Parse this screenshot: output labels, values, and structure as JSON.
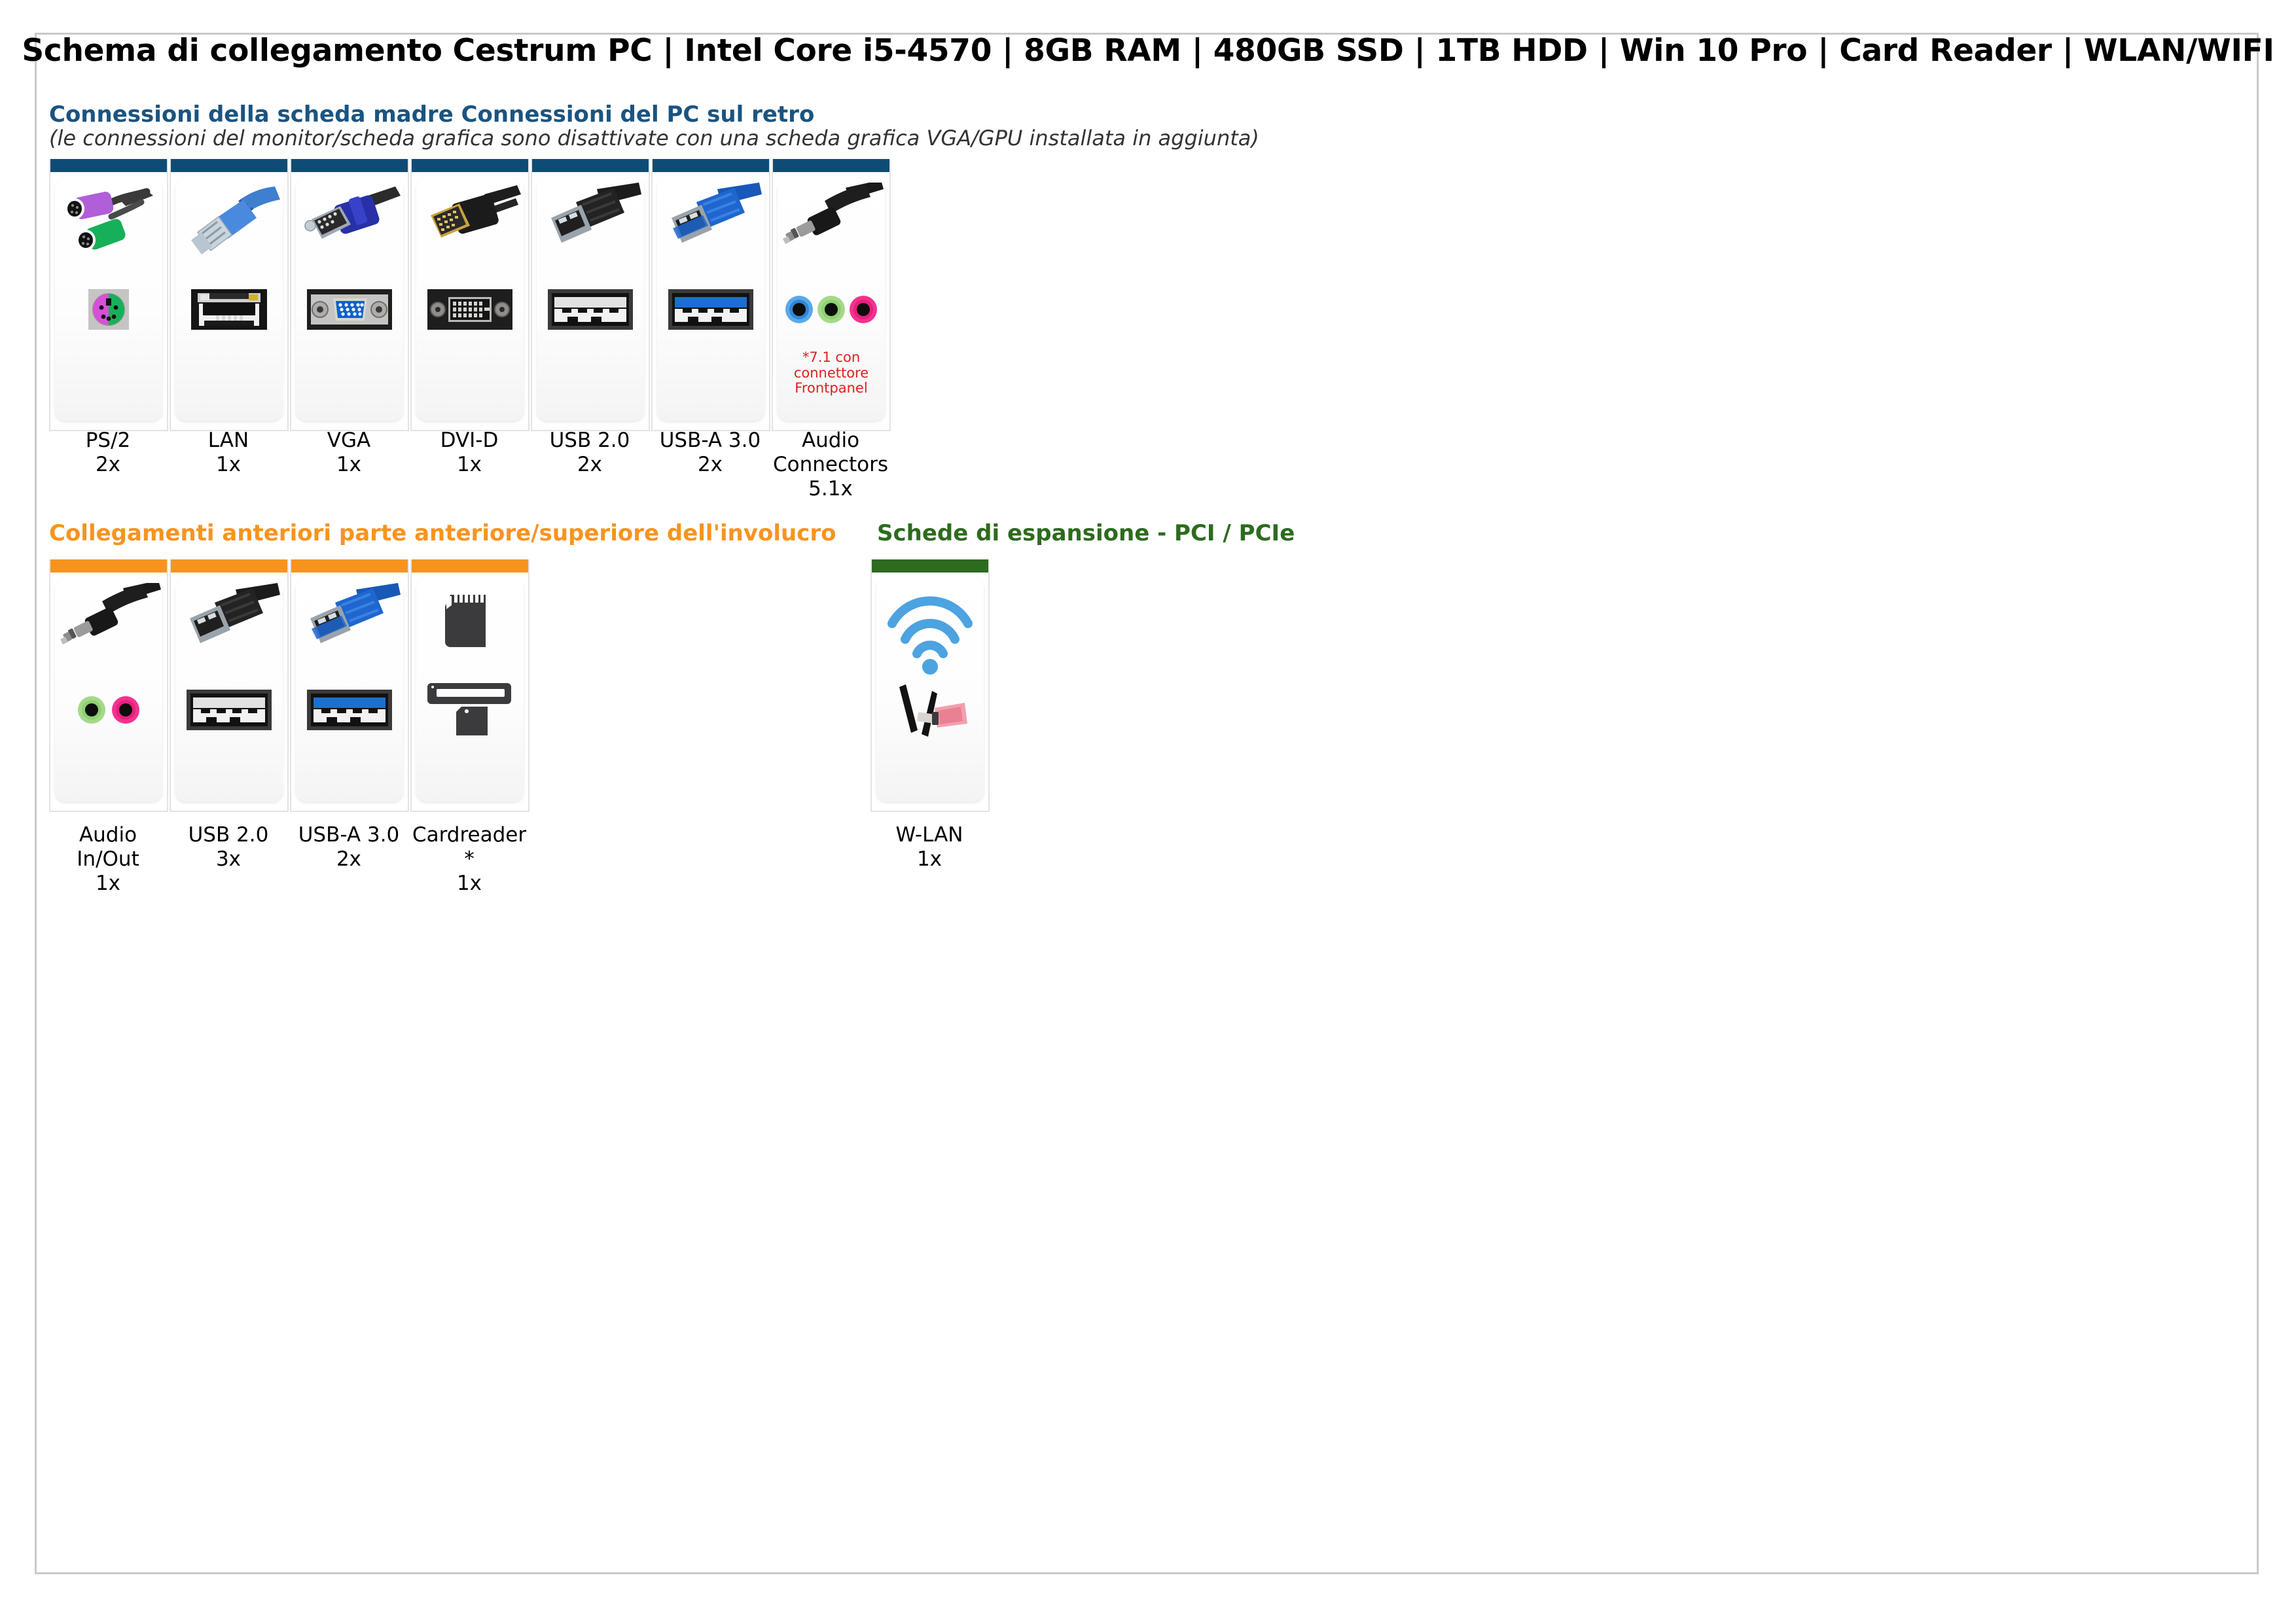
{
  "document": {
    "title": "Schema di collegamento Cestrum PC | Intel Core i5-4570 | 8GB RAM | 480GB SSD | 1TB HDD | Win 10 Pro | Card Reader | WLAN/WIFI"
  },
  "sections": {
    "rear": {
      "heading": "Connessioni della scheda madre Connessioni del PC sul retro",
      "subheading": "(le connessioni del monitor/scheda grafica sono disattivate con una scheda grafica VGA/GPU installata in aggiunta)",
      "accent_color": "#0f4c75",
      "heading_color": "#1a5481",
      "cards": [
        {
          "icon": "ps2-connector-icon",
          "label": "PS/2",
          "count": "2x",
          "note": ""
        },
        {
          "icon": "lan-rj45-icon",
          "label": "LAN",
          "count": "1x",
          "note": ""
        },
        {
          "icon": "vga-connector-icon",
          "label": "VGA",
          "count": "1x",
          "note": ""
        },
        {
          "icon": "dvi-d-connector-icon",
          "label": "DVI-D",
          "count": "1x",
          "note": ""
        },
        {
          "icon": "usb-2-icon",
          "label": "USB 2.0",
          "count": "2x",
          "note": ""
        },
        {
          "icon": "usb-a-3-icon",
          "label": "USB-A 3.0",
          "count": "2x",
          "note": ""
        },
        {
          "icon": "audio-jack-icon",
          "label": "Audio Connectors",
          "count": "5.1x",
          "note": "*7.1 con connettore Frontpanel"
        }
      ]
    },
    "front": {
      "heading": "Collegamenti anteriori parte anteriore/superiore dell'involucro",
      "accent_color": "#F7941E",
      "heading_color": "#F7941E",
      "cards": [
        {
          "icon": "audio-jack-icon",
          "label": "Audio In/Out",
          "count": "1x",
          "note": ""
        },
        {
          "icon": "usb-2-icon",
          "label": "USB 2.0",
          "count": "3x",
          "note": ""
        },
        {
          "icon": "usb-a-3-icon",
          "label": "USB-A 3.0",
          "count": "2x",
          "note": ""
        },
        {
          "icon": "sd-cardreader-icon",
          "label": "Cardreader",
          "count": "*\n1x",
          "note": ""
        }
      ]
    },
    "expansion": {
      "heading": "Schede di espansione - PCI / PCIe",
      "accent_color": "#2D6B1E",
      "heading_color": "#2D6B1E",
      "cards": [
        {
          "icon": "wifi-antenna-icon",
          "label": "W-LAN",
          "count": "1x",
          "note": ""
        }
      ]
    }
  }
}
